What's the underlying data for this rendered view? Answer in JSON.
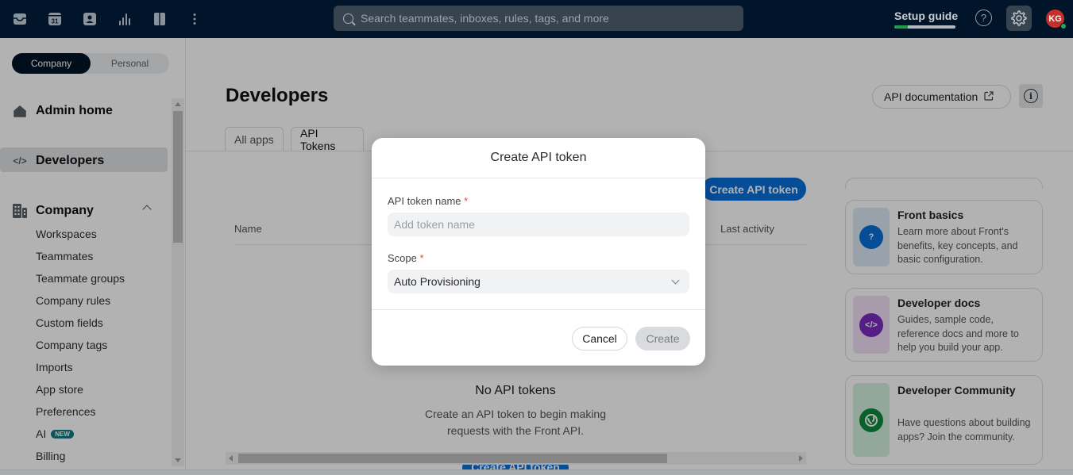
{
  "topbar": {
    "nav_icons": [
      "inbox-icon",
      "calendar-icon",
      "contacts-icon",
      "analytics-icon",
      "knowledge-base-icon",
      "more-icon"
    ],
    "calendar_day": "31",
    "search": {
      "placeholder": "Search teammates, inboxes, rules, tags, and more",
      "value": ""
    },
    "setup_guide": {
      "label": "Setup guide",
      "progress_percent": 22
    },
    "help_glyph": "?",
    "avatar": {
      "initials": "KG",
      "status": "online"
    }
  },
  "sidebar": {
    "segment": {
      "options": [
        "Company",
        "Personal"
      ],
      "selected": "Company"
    },
    "main_items": [
      {
        "label": "Admin home",
        "icon": "home-icon"
      },
      {
        "label": "Developers",
        "icon": "code-icon",
        "active": true
      },
      {
        "label": "Company",
        "icon": "building-icon",
        "expanded": true
      }
    ],
    "sub_items": [
      {
        "label": "Workspaces"
      },
      {
        "label": "Teammates"
      },
      {
        "label": "Teammate groups"
      },
      {
        "label": "Company rules"
      },
      {
        "label": "Custom fields"
      },
      {
        "label": "Company tags"
      },
      {
        "label": "Imports"
      },
      {
        "label": "App store"
      },
      {
        "label": "Preferences"
      },
      {
        "label": "AI",
        "badge": "NEW"
      },
      {
        "label": "Billing"
      }
    ]
  },
  "main": {
    "title": "Developers",
    "api_doc_label": "API documentation",
    "tabs": [
      {
        "label": "All apps"
      },
      {
        "label": "API Tokens",
        "active": true
      }
    ],
    "create_button": "Create API token",
    "table_headers": [
      "Name",
      "Last activity"
    ],
    "empty": {
      "title": "No API tokens",
      "description": "Create an API token to begin making requests with the Front API.",
      "button": "Create API token"
    },
    "resources": [
      {
        "title": "Front basics",
        "description": "Learn more about Front's benefits, key concepts, and basic configuration.",
        "icon": "question-icon",
        "glyph": "?",
        "color": "#0a6fd8",
        "bg": "#dbe8f5"
      },
      {
        "title": "Developer docs",
        "description": "Guides, sample code, reference docs and more to help you build your app.",
        "icon": "code-icon",
        "glyph": "</>",
        "color": "#7b2cbf",
        "bg": "#efdff7"
      },
      {
        "title": "Developer Community",
        "description": "Have questions about building apps? Join the community.",
        "icon": "community-icon",
        "glyph": "",
        "color": "#0c8a3e",
        "bg": "#d3f0df"
      }
    ]
  },
  "modal": {
    "title": "Create API token",
    "name_label": "API token name",
    "name_placeholder": "Add token name",
    "name_value": "",
    "required_mark": "*",
    "scope_label": "Scope",
    "scope_value": "Auto Provisioning",
    "cancel": "Cancel",
    "create": "Create"
  }
}
